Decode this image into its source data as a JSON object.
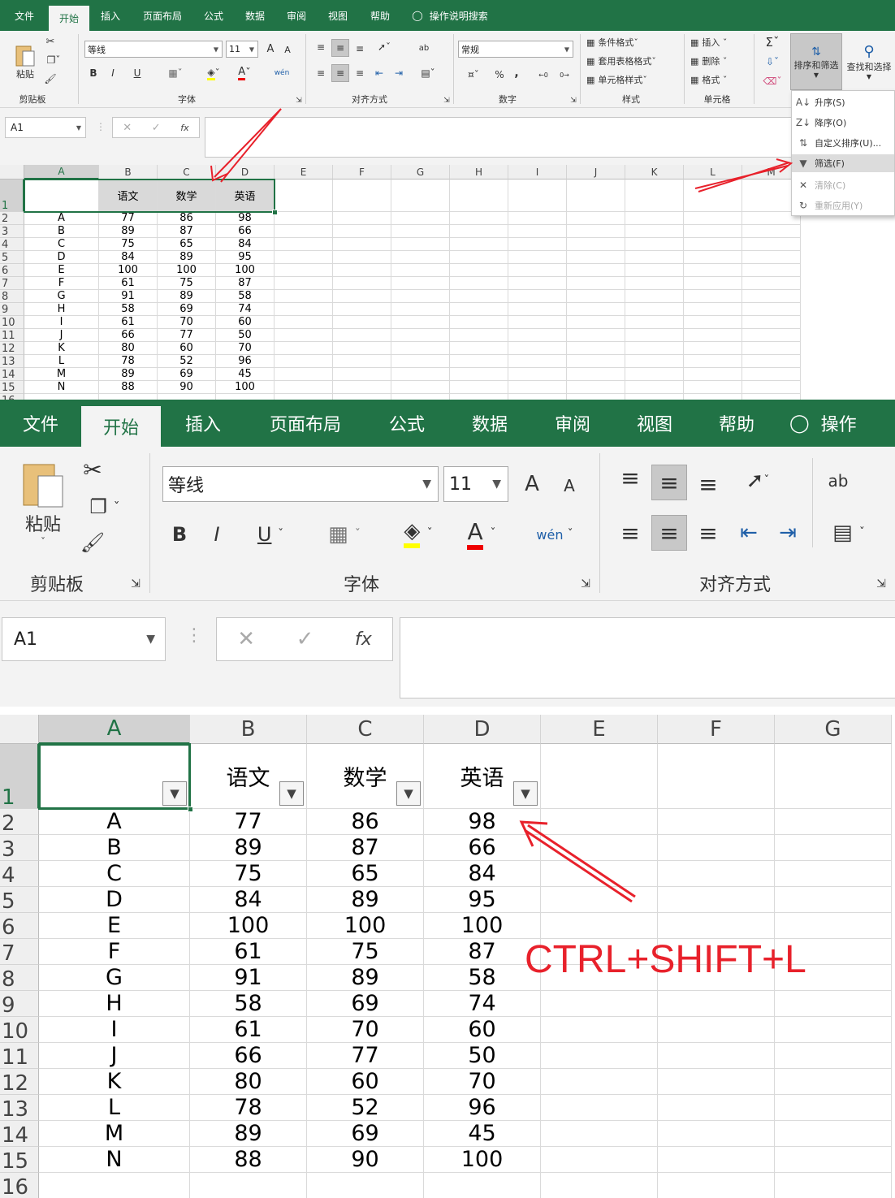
{
  "ribbon": {
    "tabs": [
      "文件",
      "开始",
      "插入",
      "页面布局",
      "公式",
      "数据",
      "审阅",
      "视图",
      "帮助"
    ],
    "active_tab": "开始",
    "tell_me": "操作说明搜索",
    "tell_me_short": "操作",
    "clipboard": {
      "paste": "粘贴",
      "title": "剪贴板"
    },
    "font": {
      "name": "等线",
      "size": "11",
      "title": "字体",
      "bold": "B",
      "italic": "I",
      "underline": "U",
      "grow": "A",
      "shrink": "A",
      "font_color": "A",
      "phonetic": "wén"
    },
    "alignment": {
      "title": "对齐方式"
    },
    "number": {
      "format": "常规",
      "title": "数字",
      "percent": "%",
      "comma": ","
    },
    "styles": {
      "conditional": "条件格式",
      "table": "套用表格格式",
      "cell_styles": "单元格样式",
      "title": "样式"
    },
    "cells": {
      "insert": "插入",
      "delete": "删除",
      "format": "格式",
      "title": "单元格"
    },
    "editing": {
      "sort_filter": "排序和筛选",
      "find_select": "查找和选择"
    }
  },
  "formula_bar": {
    "name_box": "A1",
    "fx": "fx"
  },
  "sort_menu": {
    "items": [
      {
        "label": "升序(S)",
        "icon": "sort-asc-icon",
        "state": "normal"
      },
      {
        "label": "降序(O)",
        "icon": "sort-desc-icon",
        "state": "normal"
      },
      {
        "label": "自定义排序(U)...",
        "icon": "custom-sort-icon",
        "state": "normal"
      },
      {
        "label": "筛选(F)",
        "icon": "filter-icon",
        "state": "highlighted"
      },
      {
        "label": "清除(C)",
        "icon": "clear-filter-icon",
        "state": "disabled"
      },
      {
        "label": "重新应用(Y)",
        "icon": "reapply-icon",
        "state": "disabled"
      }
    ]
  },
  "sheet": {
    "top_columns": [
      "A",
      "B",
      "C",
      "D",
      "E",
      "F",
      "G",
      "H",
      "I",
      "J",
      "K",
      "L",
      "M"
    ],
    "bottom_columns": [
      "A",
      "B",
      "C",
      "D",
      "E",
      "F",
      "G"
    ],
    "header_row": [
      "",
      "语文",
      "数学",
      "英语"
    ],
    "rows": [
      [
        "A",
        "77",
        "86",
        "98"
      ],
      [
        "B",
        "89",
        "87",
        "66"
      ],
      [
        "C",
        "75",
        "65",
        "84"
      ],
      [
        "D",
        "84",
        "89",
        "95"
      ],
      [
        "E",
        "100",
        "100",
        "100"
      ],
      [
        "F",
        "61",
        "75",
        "87"
      ],
      [
        "G",
        "91",
        "89",
        "58"
      ],
      [
        "H",
        "58",
        "69",
        "74"
      ],
      [
        "I",
        "61",
        "70",
        "60"
      ],
      [
        "J",
        "66",
        "77",
        "50"
      ],
      [
        "K",
        "80",
        "60",
        "70"
      ],
      [
        "L",
        "78",
        "52",
        "96"
      ],
      [
        "M",
        "89",
        "69",
        "45"
      ],
      [
        "N",
        "88",
        "90",
        "100"
      ]
    ],
    "row_numbers": [
      "1",
      "2",
      "3",
      "4",
      "5",
      "6",
      "7",
      "8",
      "9",
      "10",
      "11",
      "12",
      "13",
      "14",
      "15",
      "16"
    ]
  },
  "annotation": {
    "shortcut": "CTRL+SHIFT+L"
  },
  "colors": {
    "excel_green": "#217346",
    "annotation_red": "#e8212b",
    "header_fill": "#d9d9d9"
  }
}
